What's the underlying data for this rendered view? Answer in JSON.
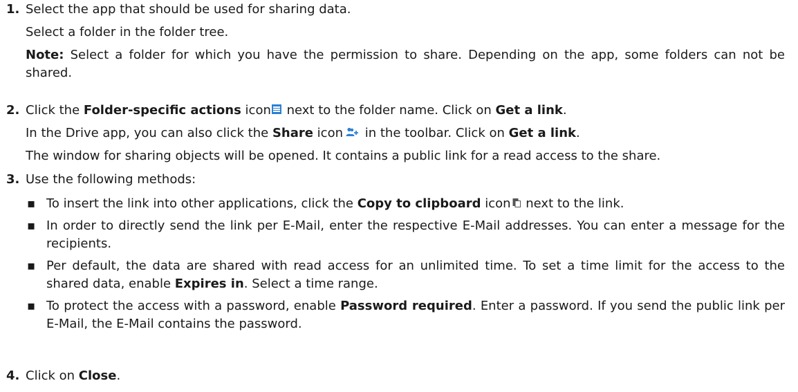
{
  "steps": [
    {
      "number": "1.",
      "lines": [
        "Select the app that should be used for sharing data.",
        "Select a folder in the folder tree."
      ],
      "note": {
        "label": "Note:",
        "text": " Select a folder for which you have the permission to share. Depending on the app, some folders can not be shared."
      }
    },
    {
      "number": "2.",
      "line1": {
        "t1": "Click the ",
        "b1": "Folder-specific actions",
        "t2": " icon",
        "t3": " next to the folder name. Click on ",
        "b2": "Get a link",
        "t4": "."
      },
      "line2": {
        "t1": "In the Drive app, you can also click the ",
        "b1": "Share",
        "t2": " icon",
        "t3": " in the toolbar. Click on ",
        "b2": "Get a link",
        "t4": "."
      },
      "line3": "The window for sharing objects will be opened. It contains a public link for a read access to the share."
    },
    {
      "number": "3.",
      "intro": "Use the following methods:",
      "bullet_char": "▪",
      "bullets": [
        {
          "t1": "To insert the link into other applications, click the ",
          "b1": "Copy to clipboard",
          "t2": " icon",
          "t3": " next to the link."
        },
        {
          "t1": "In order to directly send the link per E-Mail, enter the respective E-Mail addresses. You can enter a message for the recipients."
        },
        {
          "t1": "Per default, the data are shared with read access for an unlimited time. To set a time limit for the access to the shared data, enable ",
          "b1": "Expires in",
          "t2": ". Select a time range."
        },
        {
          "t1": "To protect the access with a password, enable ",
          "b1": "Password required",
          "t2": ". Enter a password. If you send the public link per E-Mail, the E-Mail contains the password."
        }
      ]
    },
    {
      "number": "4.",
      "t1": "Click on ",
      "b1": "Close",
      "t2": "."
    }
  ],
  "icons": {
    "folder_actions": "menu-icon",
    "share": "add-user-icon",
    "clipboard": "copy-icon"
  },
  "colors": {
    "icon_blue": "#2b7fd4",
    "text": "#1a1a1a"
  }
}
